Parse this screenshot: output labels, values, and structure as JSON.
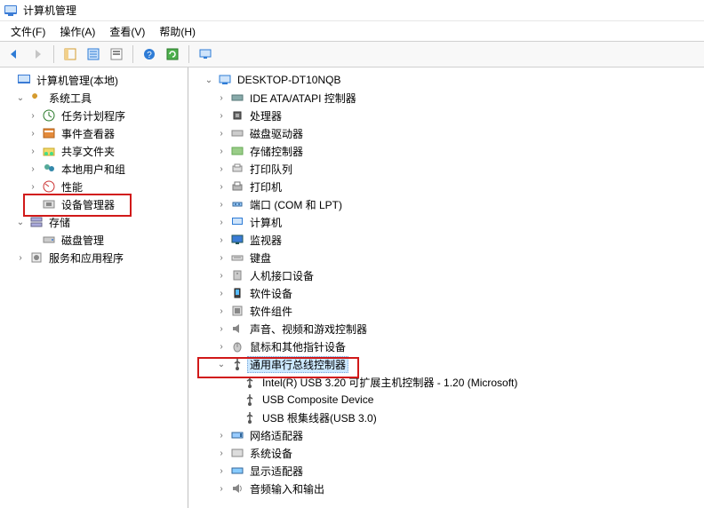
{
  "window": {
    "title": "计算机管理"
  },
  "menu": {
    "file": "文件(F)",
    "action": "操作(A)",
    "view": "查看(V)",
    "help": "帮助(H)"
  },
  "left_tree": {
    "root": "计算机管理(本地)",
    "system_tools": "系统工具",
    "task_scheduler": "任务计划程序",
    "event_viewer": "事件查看器",
    "shared_folders": "共享文件夹",
    "local_users": "本地用户和组",
    "performance": "性能",
    "device_manager": "设备管理器",
    "storage": "存储",
    "disk_management": "磁盘管理",
    "services_apps": "服务和应用程序"
  },
  "right_tree": {
    "computer": "DESKTOP-DT10NQB",
    "ide": "IDE ATA/ATAPI 控制器",
    "processors": "处理器",
    "disk_drives": "磁盘驱动器",
    "storage_controllers": "存储控制器",
    "print_queues": "打印队列",
    "printers": "打印机",
    "ports": "端口 (COM 和 LPT)",
    "computers": "计算机",
    "monitors": "监视器",
    "keyboards": "键盘",
    "hid": "人机接口设备",
    "software_devices": "软件设备",
    "software_components": "软件组件",
    "sound": "声音、视频和游戏控制器",
    "mice": "鼠标和其他指针设备",
    "usb_controllers": "通用串行总线控制器",
    "usb_child_1": "Intel(R) USB 3.20 可扩展主机控制器 - 1.20 (Microsoft)",
    "usb_child_2": "USB Composite Device",
    "usb_child_3": "USB 根集线器(USB 3.0)",
    "network_adapters": "网络适配器",
    "system_devices": "系统设备",
    "display_adapters": "显示适配器",
    "audio_io": "音频输入和输出"
  }
}
